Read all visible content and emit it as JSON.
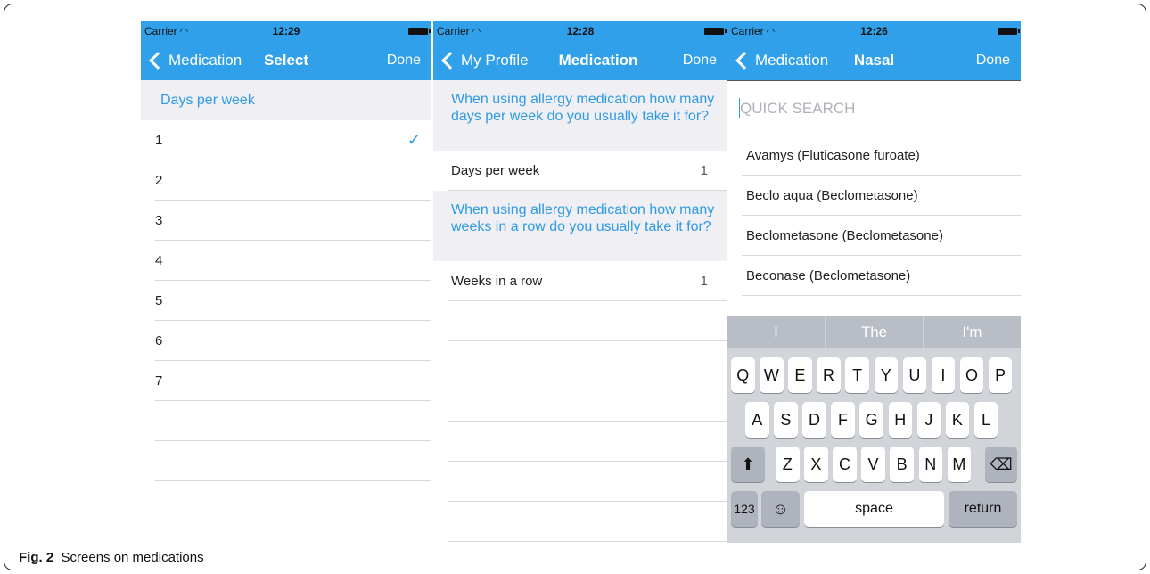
{
  "caption": {
    "label": "Fig. 2",
    "text": "Screens on medications"
  },
  "screens": [
    {
      "status": {
        "carrier": "Carrier",
        "time": "12:29"
      },
      "nav": {
        "back": "Medication",
        "title": "Select",
        "done": "Done"
      },
      "header": "Days per week",
      "options": [
        "1",
        "2",
        "3",
        "4",
        "5",
        "6",
        "7"
      ],
      "selected_index": 0
    },
    {
      "status": {
        "carrier": "Carrier",
        "time": "12:28"
      },
      "nav": {
        "back": "My Profile",
        "title": "Medication",
        "done": "Done"
      },
      "question1": "When using allergy medication how many days per week do you usually take it for?",
      "row1": {
        "label": "Days per week",
        "value": "1"
      },
      "question2": "When using allergy medication how many weeks in a row do you usually take it for?",
      "row2": {
        "label": "Weeks in a row",
        "value": "1"
      }
    },
    {
      "status": {
        "carrier": "Carrier",
        "time": "12:26"
      },
      "nav": {
        "back": "Medication",
        "title": "Nasal",
        "done": "Done"
      },
      "search_placeholder": "QUICK SEARCH",
      "medications": [
        "Avamys (Fluticasone furoate)",
        "Beclo aqua (Beclometasone)",
        "Beclometasone (Beclometasone)",
        "Beconase (Beclometasone)"
      ],
      "keyboard": {
        "suggestions": [
          "I",
          "The",
          "I'm"
        ],
        "row1": [
          "Q",
          "W",
          "E",
          "R",
          "T",
          "Y",
          "U",
          "I",
          "O",
          "P"
        ],
        "row2": [
          "A",
          "S",
          "D",
          "F",
          "G",
          "H",
          "J",
          "K",
          "L"
        ],
        "row3": [
          "Z",
          "X",
          "C",
          "V",
          "B",
          "N",
          "M"
        ],
        "numbers_key": "123",
        "space_key": "space",
        "return_key": "return",
        "shift_icon": "shift-arrow-icon",
        "delete_icon": "backspace-icon",
        "emoji_icon": "emoji-icon"
      }
    }
  ]
}
